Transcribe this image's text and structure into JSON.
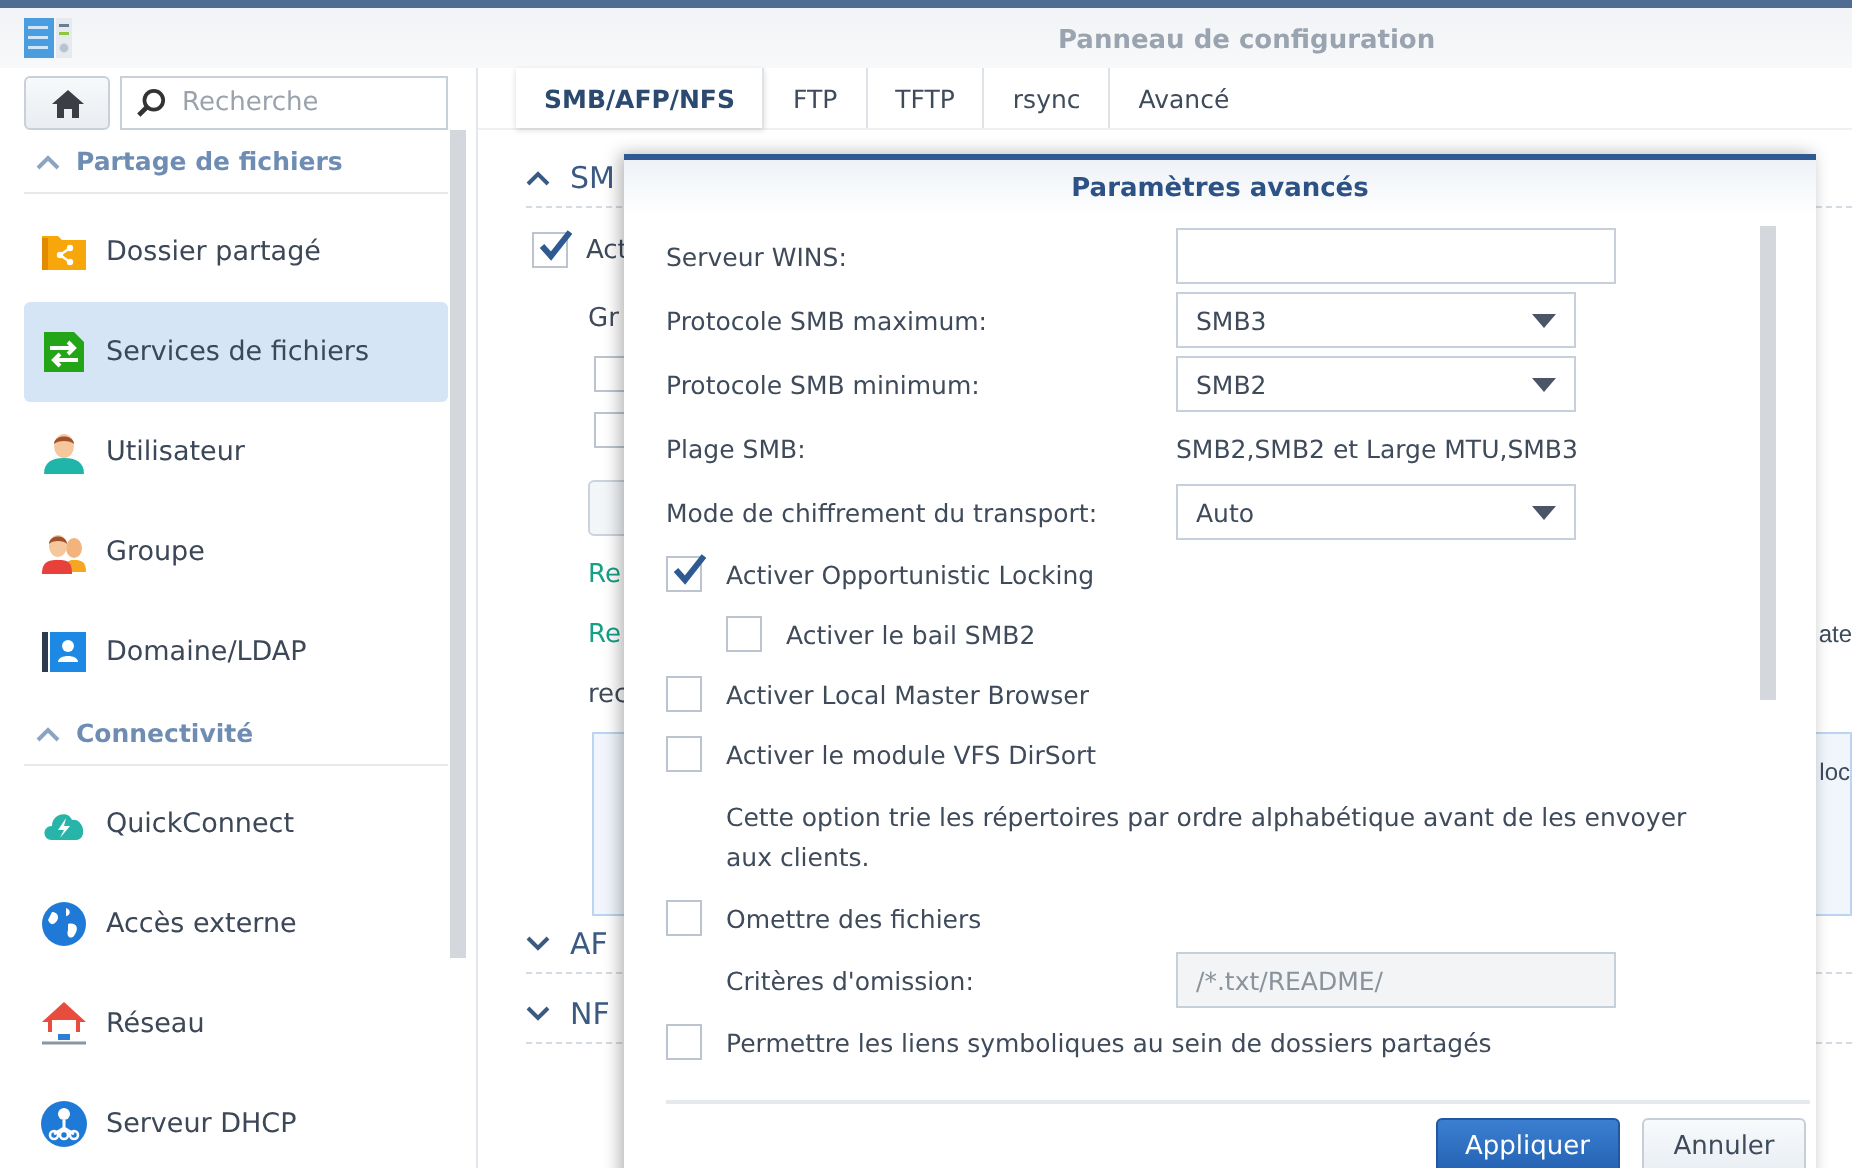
{
  "window": {
    "title": "Panneau de configuration"
  },
  "sidebar": {
    "search": {
      "placeholder": "Recherche"
    },
    "sections": [
      {
        "title": "Partage de fichiers",
        "expanded": true,
        "items": [
          {
            "label": "Dossier partagé",
            "selected": false
          },
          {
            "label": "Services de fichiers",
            "selected": true
          },
          {
            "label": "Utilisateur",
            "selected": false
          },
          {
            "label": "Groupe",
            "selected": false
          },
          {
            "label": "Domaine/LDAP",
            "selected": false
          }
        ]
      },
      {
        "title": "Connectivité",
        "expanded": true,
        "items": [
          {
            "label": "QuickConnect",
            "selected": false
          },
          {
            "label": "Accès externe",
            "selected": false
          },
          {
            "label": "Réseau",
            "selected": false
          },
          {
            "label": "Serveur DHCP",
            "selected": false
          }
        ]
      }
    ]
  },
  "tabs": [
    {
      "label": "SMB/AFP/NFS",
      "selected": true
    },
    {
      "label": "FTP",
      "selected": false
    },
    {
      "label": "TFTP",
      "selected": false
    },
    {
      "label": "rsync",
      "selected": false
    },
    {
      "label": "Avancé",
      "selected": false
    }
  ],
  "main": {
    "smb_section": {
      "title": "SM",
      "expanded": true
    },
    "enable_checkbox": {
      "label": "Act",
      "checked": true
    },
    "group_label": "Gr",
    "option_checkboxes": [
      {
        "checked": false
      },
      {
        "checked": false
      }
    ],
    "note_1": "Re",
    "note_2": {
      "line_1_start": "Re",
      "line_1_end": "ate",
      "line_2": "rec"
    },
    "info_box": {
      "end": "loc"
    },
    "collapsed_sections": [
      {
        "title": "AF",
        "expanded": false
      },
      {
        "title": "NF",
        "expanded": false
      }
    ]
  },
  "modal": {
    "title": "Paramètres avancés",
    "rows": [
      {
        "kind": "input",
        "label": "Serveur WINS:"
      },
      {
        "kind": "select",
        "label": "Protocole SMB maximum:",
        "value": "SMB3"
      },
      {
        "kind": "select",
        "label": "Protocole SMB minimum:",
        "value": "SMB2"
      },
      {
        "kind": "static",
        "label": "Plage SMB:",
        "value": "SMB2,SMB2 et Large MTU,SMB3"
      },
      {
        "kind": "select",
        "label": "Mode de chiffrement du transport:",
        "value": "Auto"
      },
      {
        "kind": "checkbox",
        "label": "Activer Opportunistic Locking",
        "checked": true,
        "children": [
          {
            "kind": "checkbox",
            "label": "Activer le bail SMB2",
            "checked": false
          }
        ]
      },
      {
        "kind": "checkbox",
        "label": "Activer Local Master Browser",
        "checked": false
      },
      {
        "kind": "checkbox",
        "label": "Activer le module VFS DirSort",
        "checked": false,
        "children": [
          {
            "kind": "note",
            "text": "Cette option trie les répertoires par ordre alphabétique avant de les envoyer aux clients."
          }
        ]
      },
      {
        "kind": "checkbox",
        "label": "Omettre des fichiers",
        "checked": false,
        "children": [
          {
            "kind": "input",
            "label": "Critères d'omission:",
            "value": "/*.txt/README/",
            "disabled": true
          }
        ]
      },
      {
        "kind": "checkbox",
        "label": "Permettre les liens symboliques au sein de dossiers partagés",
        "checked": false
      }
    ],
    "buttons": [
      {
        "label": "Appliquer",
        "primary": true
      },
      {
        "label": "Annuler",
        "primary": false
      }
    ]
  }
}
